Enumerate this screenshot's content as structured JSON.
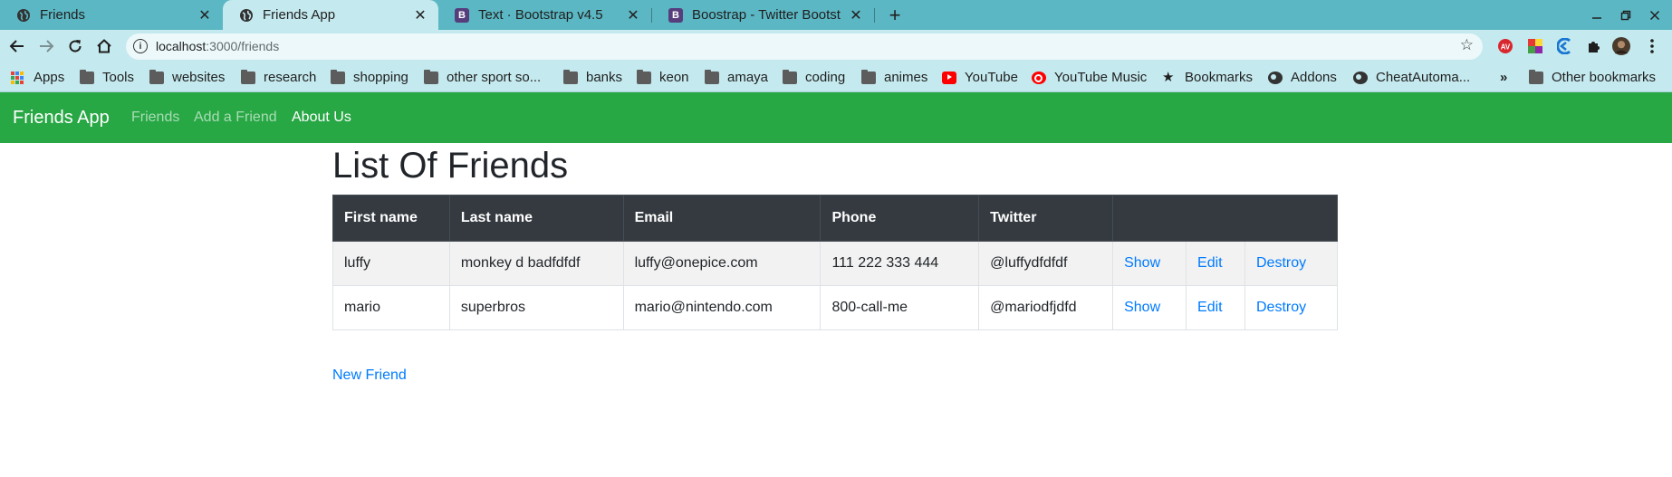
{
  "browser": {
    "tabs": [
      {
        "title": "Friends",
        "favicon": "globe-icon",
        "active": false
      },
      {
        "title": "Friends App",
        "favicon": "globe-icon",
        "active": true
      },
      {
        "title": "Text · Bootstrap v4.5",
        "favicon": "bootstrap-icon",
        "active": false
      },
      {
        "title": "Boostrap - Twitter Bootst",
        "favicon": "bootstrap-icon",
        "active": false
      }
    ],
    "url_host": "localhost",
    "url_path": ":3000/friends",
    "bookmarks": [
      {
        "label": "Apps",
        "icon": "apps-grid-icon"
      },
      {
        "label": "Tools",
        "icon": "folder-icon"
      },
      {
        "label": "websites",
        "icon": "folder-icon"
      },
      {
        "label": "research",
        "icon": "folder-icon"
      },
      {
        "label": "shopping",
        "icon": "folder-icon"
      },
      {
        "label": "other sport so...",
        "icon": "folder-icon"
      },
      {
        "label": "banks",
        "icon": "folder-icon"
      },
      {
        "label": "keon",
        "icon": "folder-icon"
      },
      {
        "label": "amaya",
        "icon": "folder-icon"
      },
      {
        "label": "coding",
        "icon": "folder-icon"
      },
      {
        "label": "animes",
        "icon": "folder-icon"
      },
      {
        "label": "YouTube",
        "icon": "youtube-icon"
      },
      {
        "label": "YouTube Music",
        "icon": "youtube-music-icon"
      },
      {
        "label": "Bookmarks",
        "icon": "star-icon"
      },
      {
        "label": "Addons",
        "icon": "globe-icon"
      },
      {
        "label": "CheatAutoma...",
        "icon": "globe-icon"
      }
    ],
    "more_bookmarks": "»",
    "other_bookmarks": "Other bookmarks"
  },
  "app": {
    "brand": "Friends App",
    "nav": [
      {
        "label": "Friends",
        "color": "#a8dcb4"
      },
      {
        "label": "Add a Friend",
        "color": "#a8dcb4"
      },
      {
        "label": "About Us",
        "color": "#ffffff"
      }
    ],
    "heading": "List Of Friends",
    "table": {
      "headers": [
        "First name",
        "Last name",
        "Email",
        "Phone",
        "Twitter",
        ""
      ],
      "rows": [
        {
          "first": "luffy",
          "last": "monkey d badfdfdf",
          "email": "luffy@onepice.com",
          "phone": "111 222 333 444",
          "twitter": "@luffydfdfdf",
          "show": "Show",
          "edit": "Edit",
          "destroy": "Destroy"
        },
        {
          "first": "mario",
          "last": "superbros",
          "email": "mario@nintendo.com",
          "phone": "800-call-me",
          "twitter": "@mariodfjdfd",
          "show": "Show",
          "edit": "Edit",
          "destroy": "Destroy"
        }
      ]
    },
    "new_friend": "New Friend"
  },
  "colors": {
    "navbar": "#28a745",
    "link": "#007bff",
    "table_header": "#343a40",
    "tab_strip": "#5bb7c3",
    "toolbar": "#c4e9ee"
  }
}
